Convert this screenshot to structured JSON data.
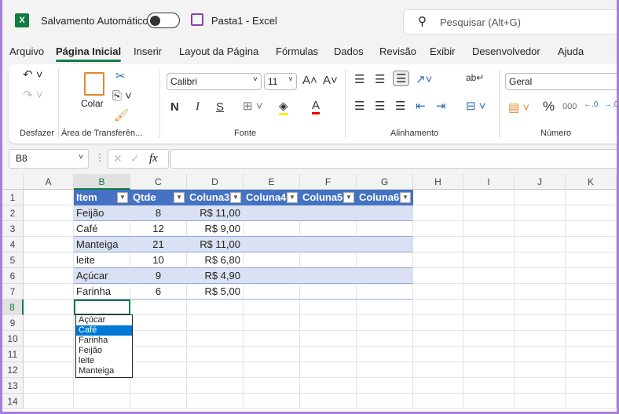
{
  "titlebar": {
    "autosave_label": "Salvamento Automático",
    "doc_title": "Pasta1  -  Excel",
    "search_placeholder": "Pesquisar (Alt+G)",
    "app_icon": "X"
  },
  "tabs": [
    "Arquivo",
    "Página Inicial",
    "Inserir",
    "Layout da Página",
    "Fórmulas",
    "Dados",
    "Revisão",
    "Exibir",
    "Desenvolvedor",
    "Ajuda"
  ],
  "active_tab": "Página Inicial",
  "ribbon": {
    "undo_group": "Desfazer",
    "clipboard_group": "Área de Transferên...",
    "paste_label": "Colar",
    "font_group": "Fonte",
    "font_name": "Calibri",
    "font_size": "11",
    "bold": "N",
    "italic": "I",
    "underline": "S",
    "align_group": "Alinhamento",
    "number_group": "Número",
    "number_format": "Geral",
    "percent": "%",
    "thousands": "000"
  },
  "formula_bar": {
    "name_box": "B8",
    "fx": "fx",
    "value": ""
  },
  "columns": [
    "A",
    "B",
    "C",
    "D",
    "E",
    "F",
    "G",
    "H",
    "I",
    "J",
    "K"
  ],
  "rows": [
    "1",
    "2",
    "3",
    "4",
    "5",
    "6",
    "7",
    "8",
    "9",
    "10",
    "11",
    "12",
    "13",
    "14"
  ],
  "table": {
    "headers": [
      "Item",
      "Qtde",
      "Coluna3",
      "Coluna4",
      "Coluna5",
      "Coluna6"
    ],
    "data": [
      [
        "Feijão",
        "8",
        "R$ 11,00"
      ],
      [
        "Café",
        "12",
        "R$ 9,00"
      ],
      [
        "Manteiga",
        "21",
        "R$ 11,00"
      ],
      [
        "leite",
        "10",
        "R$ 6,80"
      ],
      [
        "Açúcar",
        "9",
        "R$ 4,90"
      ],
      [
        "Farinha",
        "6",
        "R$ 5,00"
      ]
    ]
  },
  "dropdown": {
    "options": [
      "Açúcar",
      "Café",
      "Farinha",
      "Feijão",
      "leite",
      "Manteiga"
    ],
    "selected": "Café"
  },
  "colors": {
    "accent": "#107c41",
    "table_header": "#4472c4",
    "band": "#d9e1f2",
    "selection": "#0078d4"
  }
}
